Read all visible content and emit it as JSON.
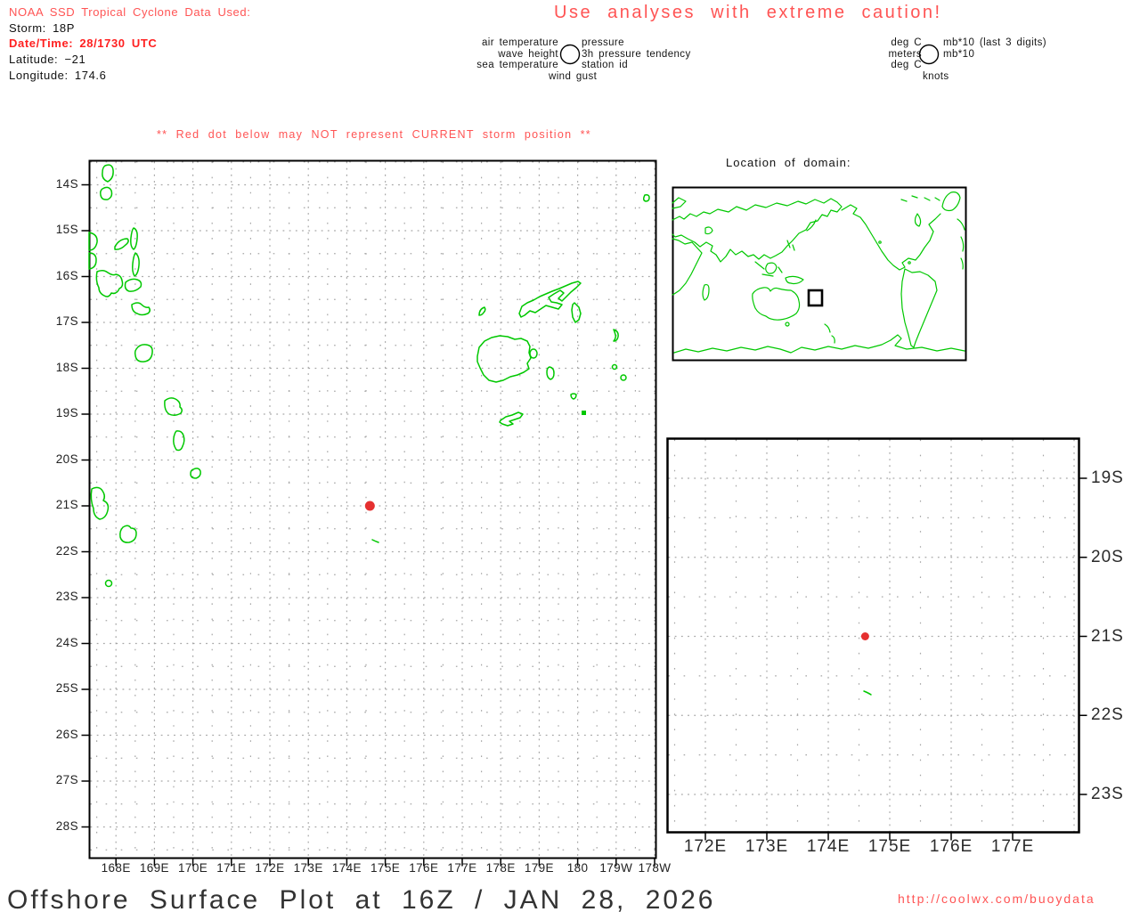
{
  "colors": {
    "green": "#00c800",
    "salmon": "#ff5454",
    "bold_red": "#ff2020",
    "dot_red": "#e53030",
    "grid_gray": "#a6a6a6"
  },
  "header": {
    "source_line": "NOAA SSD Tropical Cyclone Data Used:",
    "storm": "Storm: 18P",
    "datetime": "Date/Time: 28/1730 UTC",
    "latitude": "Latitude: −21",
    "longitude": "Longitude: 174.6"
  },
  "caution": "Use analyses with extreme caution!",
  "station_legend": {
    "left": [
      "air temperature",
      "wave height",
      "sea temperature"
    ],
    "right": [
      "pressure",
      "3h pressure tendency",
      "station id"
    ],
    "bottom": "wind gust",
    "units_left": [
      "deg C",
      "meters",
      "deg C"
    ],
    "units_right": [
      "mb*10 (last 3 digits)",
      "mb*10"
    ],
    "units_bottom": "knots"
  },
  "warning": "** Red dot below may NOT represent CURRENT storm position **",
  "main_map": {
    "lat_labels": [
      "14S",
      "15S",
      "16S",
      "17S",
      "18S",
      "19S",
      "20S",
      "21S",
      "22S",
      "23S",
      "24S",
      "25S",
      "26S",
      "27S",
      "28S"
    ],
    "lon_labels": [
      "168E",
      "169E",
      "170E",
      "171E",
      "172E",
      "173E",
      "174E",
      "175E",
      "176E",
      "177E",
      "178E",
      "179E",
      "180",
      "179W",
      "178W"
    ],
    "lat_range_deg_s": [
      13.5,
      28.6
    ],
    "lon_range_deg_e": [
      167.3,
      182.0
    ],
    "storm_dot": {
      "lat": -21,
      "lon": 174.6
    }
  },
  "domain_map": {
    "title": "Location of domain:"
  },
  "inset_map": {
    "lon_labels": [
      "172E",
      "173E",
      "174E",
      "175E",
      "176E",
      "177E"
    ],
    "lat_labels": [
      "19S",
      "20S",
      "21S",
      "22S",
      "23S"
    ],
    "lat_range_deg_s": [
      18.5,
      23.5
    ],
    "lon_range_deg_e": [
      171.4,
      178.1
    ],
    "storm_dot": {
      "lat": -21,
      "lon": 174.6
    }
  },
  "footer": {
    "title": "Offshore Surface Plot at 16Z / JAN 28, 2026",
    "url": "http://coolwx.com/buoydata"
  }
}
